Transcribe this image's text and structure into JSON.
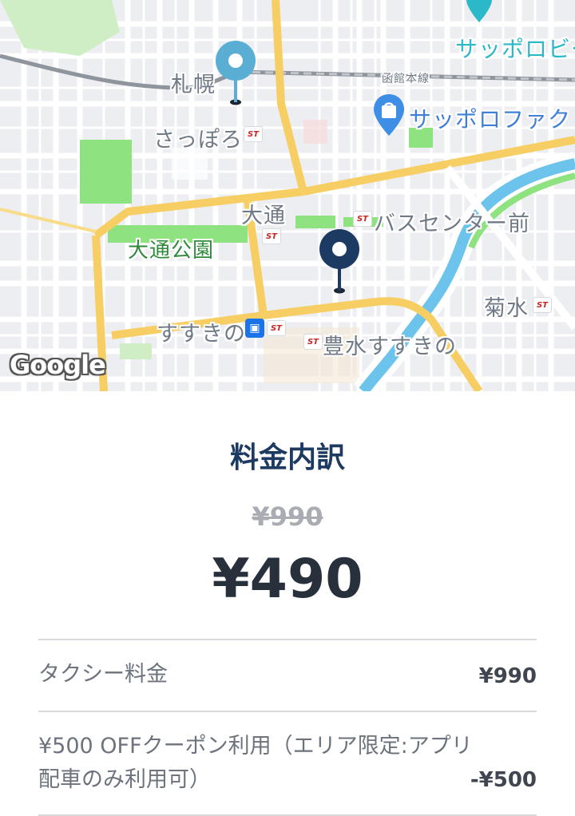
{
  "map": {
    "labels": {
      "sapporo_station_kanji": "札幌",
      "sapporo_station_kana": "さっぽろ",
      "odori": "大通",
      "odori_park": "大通公園",
      "bus_center": "バスセンター前",
      "kikusui": "菊水",
      "susukino": "すすきの",
      "hosui_susukino": "豊水すすきの",
      "sapporo_factory": "サッポロファクト",
      "sapporo_beer": "サッポロビー",
      "hakodate_line": "函館本線",
      "google": "Google"
    },
    "icons": {
      "pickup_pin": "location-pin-icon",
      "destination_pin": "location-pin-icon",
      "shopping": "shopping-bag-icon",
      "subway": "subway-icon",
      "st_badge": "ST"
    },
    "colors": {
      "pickup_pin": "#5aaed4",
      "destination_pin": "#1d3a63",
      "major_road": "#f6ce63",
      "park": "#8ee27f",
      "river": "#6cc3ec"
    }
  },
  "fare": {
    "title": "料金内訳",
    "original_price": "¥990",
    "final_price": "¥490",
    "rows": [
      {
        "label": "タクシー料金",
        "value": "¥990"
      },
      {
        "label_line1": "¥500 OFFクーポン利用（エリア限定:アプリ",
        "label_line2": "配車のみ利用可）",
        "value": "-¥500"
      }
    ]
  }
}
